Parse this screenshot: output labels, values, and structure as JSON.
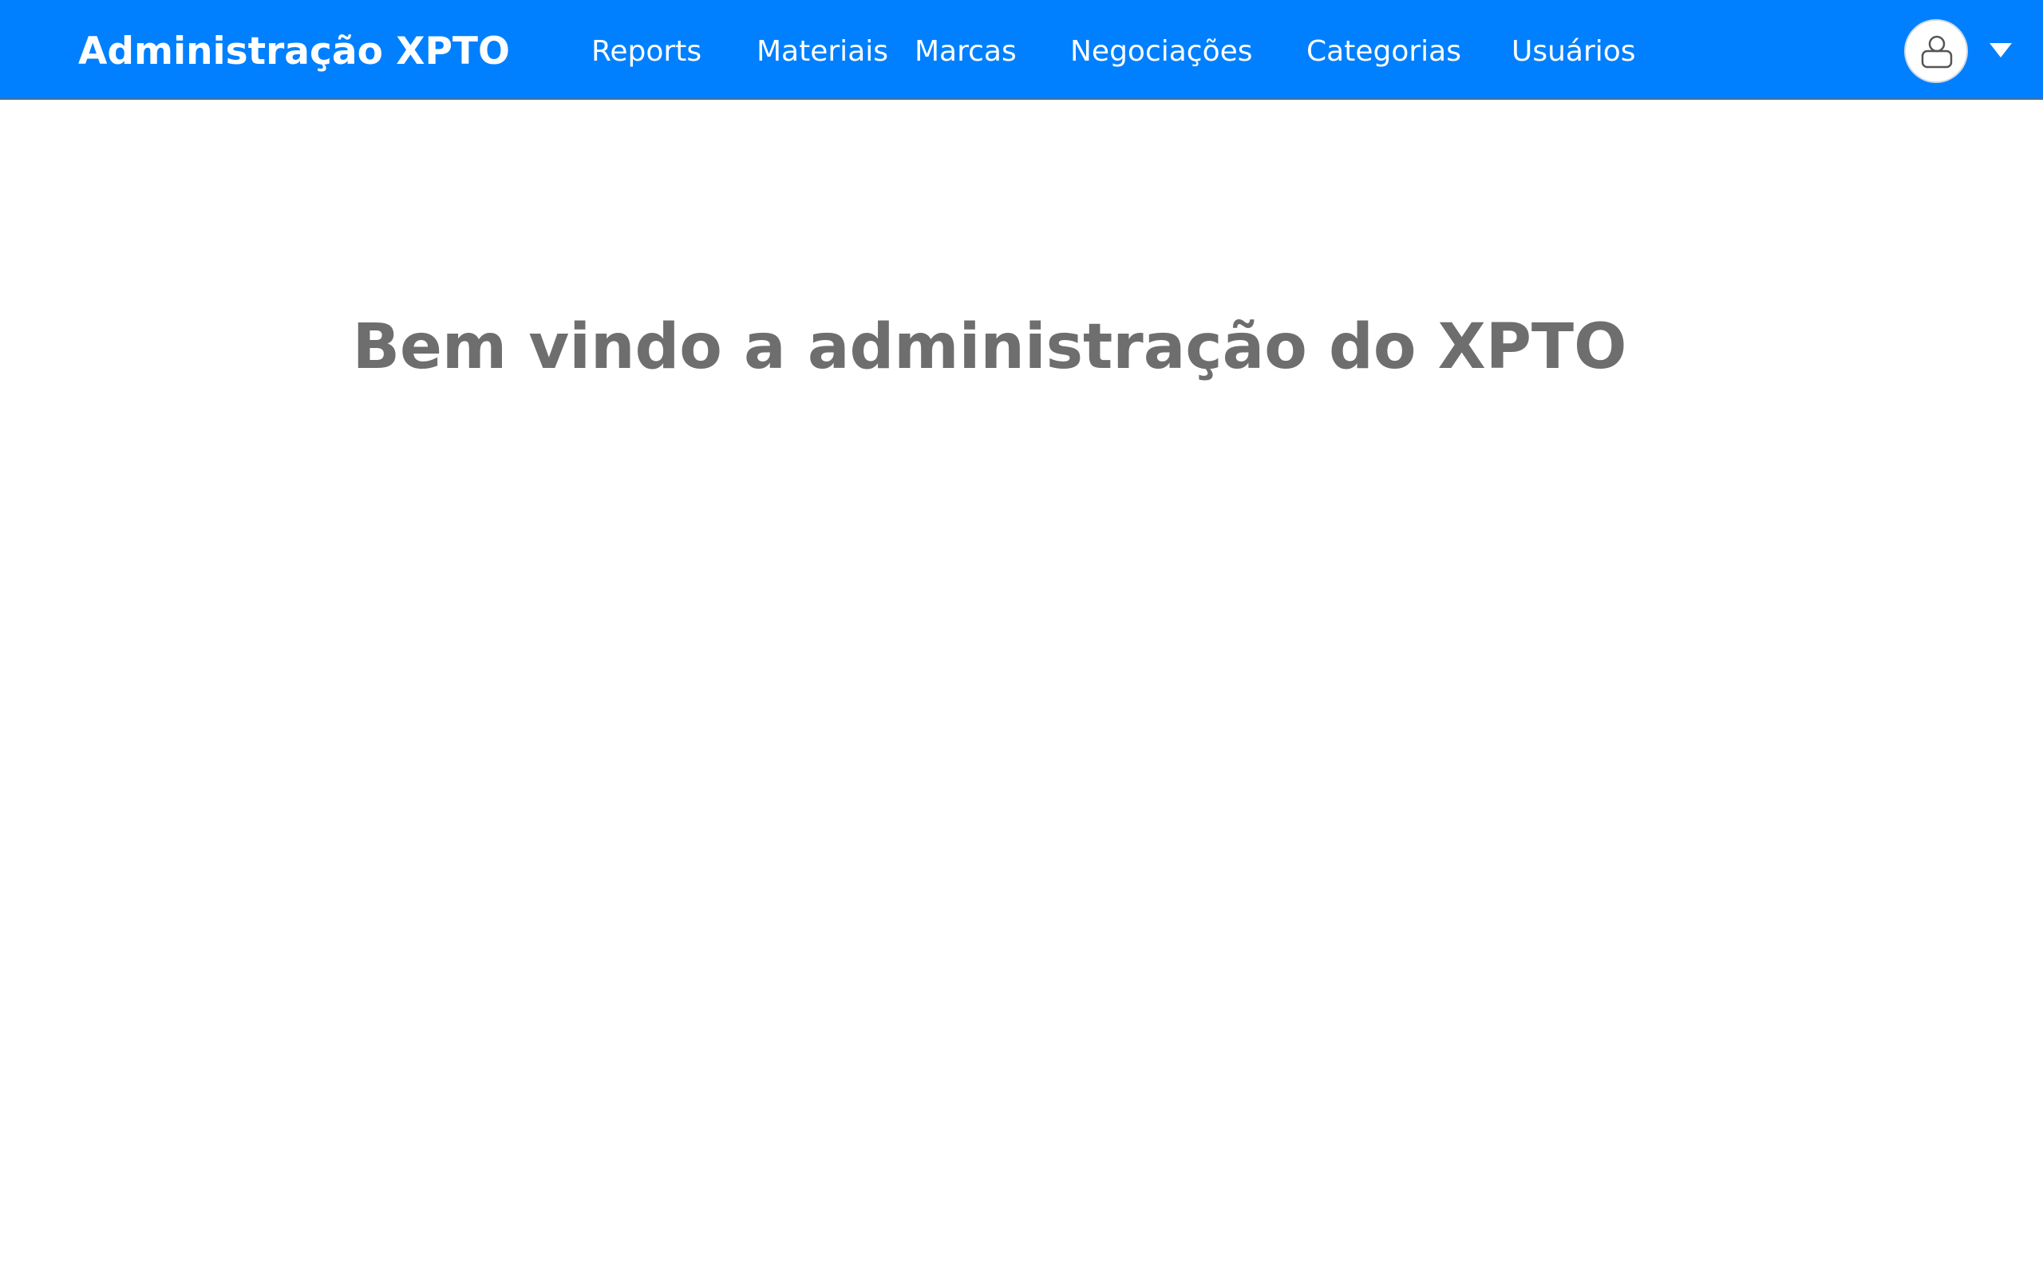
{
  "navbar": {
    "brand": "Administração XPTO",
    "background_color": "#0080fe",
    "links": [
      {
        "label": "Reports"
      },
      {
        "label": "Materiais"
      },
      {
        "label": "Marcas"
      },
      {
        "label": "Negociações"
      },
      {
        "label": "Categorias"
      },
      {
        "label": "Usuários"
      }
    ],
    "user_menu": {
      "icon": "user-icon",
      "dropdown_icon": "caret-down-icon"
    }
  },
  "main": {
    "welcome_title": "Bem vindo a administração do XPTO",
    "title_color": "#6e6e6e"
  }
}
